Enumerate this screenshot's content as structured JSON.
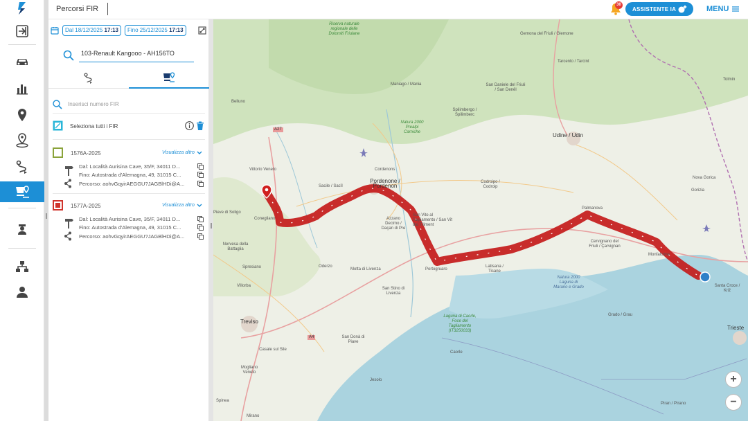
{
  "header": {
    "page_title": "Percorsi FIR",
    "notification_count": "30",
    "ai_button_label": "ASSISTENTE IA",
    "menu_label": "MENU"
  },
  "rail": {
    "items": [
      "logo-icon",
      "login-icon",
      "car-icon",
      "chart-icon",
      "location-icon",
      "pin-icon",
      "route-icon",
      "fir-route-icon",
      "driver-icon",
      "org-tree-icon",
      "user-icon"
    ],
    "active": "fir-route-icon"
  },
  "filters": {
    "date_from_label": "Dal",
    "date_from": "18/12/2025",
    "time_from": "17:13",
    "date_to_label": "Fino",
    "date_to": "25/12/2025",
    "time_to": "17:13"
  },
  "vehicle_search": {
    "value": "103-Renault Kangooo - AH156TO"
  },
  "fir_search": {
    "placeholder": "Inserisci numero FIR"
  },
  "select_all_label": "Seleziona tutti i FIR",
  "firs": [
    {
      "code": "1576A-2025",
      "color": "#8aa33a",
      "more_label": "Visualizza altro",
      "from": "Dal: Località Aurisina Cave, 35/F, 34011 D...",
      "to": "Fino: Autostrada d'Alemagna, 49, 31015 C...",
      "route": "Percorso: aohvGqyirAEGGU?JAGBlHDi@A..."
    },
    {
      "code": "1577A-2025",
      "color": "#d0342c",
      "more_label": "Visualizza altro",
      "from": "Dal: Località Aurisina Cave, 35/F, 34011 D...",
      "to": "Fino: Autostrada d'Alemagna, 49, 31015 C...",
      "route": "Percorso: aohvGqyirAEGGU?JAGBlHDi@A..."
    }
  ],
  "map": {
    "labels": [
      "Gemona del Friuli / Glemone",
      "Tarcento / Tarcint",
      "Maniago / Mania",
      "San Daniele del Friuli / San Denêl",
      "Spilimbergo / Spilimberc",
      "Udine / Udin",
      "Belluno",
      "Vittorio Veneto",
      "Conegliano",
      "Sacile / Sacîl",
      "Pordenone / Pordenon",
      "Cordenons",
      "Codroipo / Codroip",
      "Azzano Decimo / Daçan di Pre",
      "San Vito al Tagliamento / San Vît dal Tiliment",
      "Palmanova",
      "Cervignano del Friuli / Çarvignan",
      "Monfalcone",
      "Nova Gorica",
      "Gorizia",
      "Tolmin",
      "Santa Croce / Križ",
      "Trieste",
      "Oderzo",
      "Motta di Livenza",
      "Portogruaro",
      "Latisana / Tisane",
      "San Stino di Livenza",
      "Spresiano",
      "Villorba",
      "Treviso",
      "Nervesa della Battaglia",
      "Pieve di Soligo",
      "San Donà di Piave",
      "Jesolo",
      "Caorle",
      "Grado / Grau",
      "Casale sul Sile",
      "Mogliano Veneto",
      "Spinea",
      "Piran / Pirano",
      "Mirano",
      "Riserva naturale regionale delle Dolomiti Friulane",
      "Natura 2000 Prealpi Carniche",
      "Natura 2000 Laguna di Marano e Grado",
      "Laguna di Caorle, Foce del Tagliamento (IT3250033)",
      "A27",
      "A4"
    ]
  }
}
